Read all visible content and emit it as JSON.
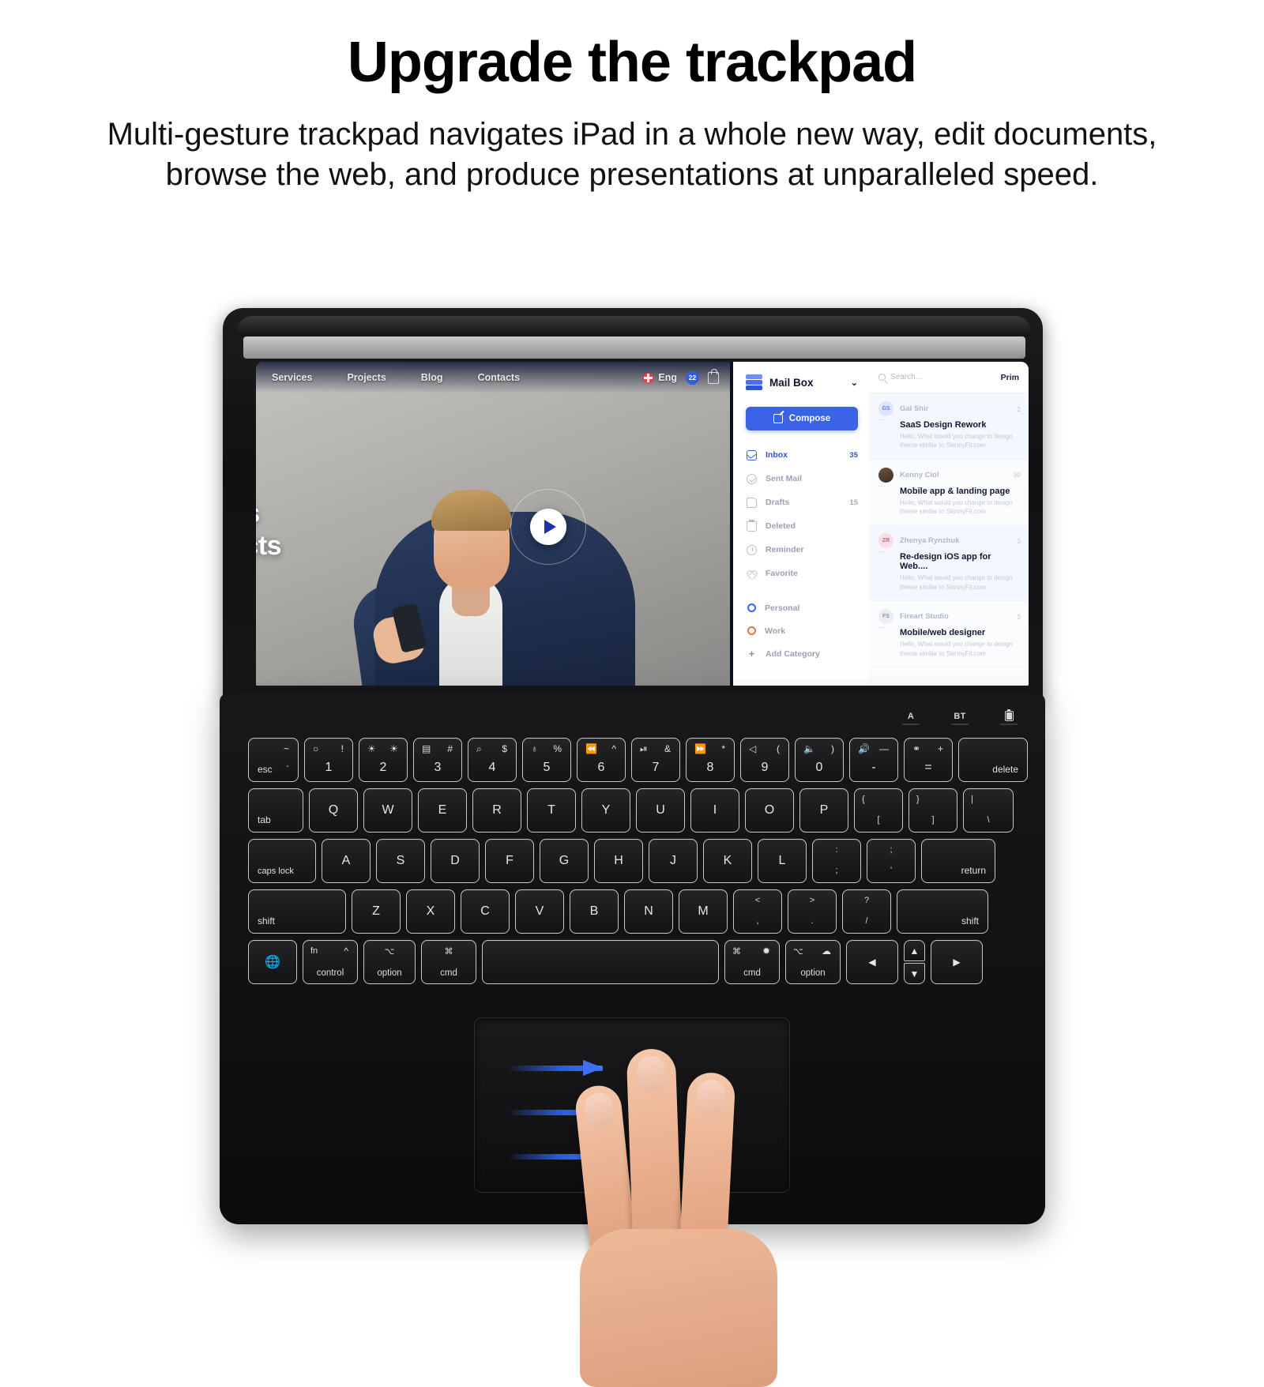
{
  "header": {
    "headline": "Upgrade the trackpad",
    "subhead": "Multi-gesture trackpad navigates iPad in a whole new way, edit documents, browse the web, and produce presentations at unparalleled speed."
  },
  "website": {
    "nav": [
      "Services",
      "Projects",
      "Blog",
      "Contacts"
    ],
    "language": "Eng",
    "cart_count": "22",
    "hero_line1": "ns",
    "hero_line2": "ects"
  },
  "mail": {
    "brand_title": "Mail Box",
    "chevron": "⌄",
    "compose_label": "Compose",
    "search_placeholder": "Search...",
    "primary_tab": "Prim",
    "folders": [
      {
        "label": "Inbox",
        "count": "35",
        "icon": "envelope-icon"
      },
      {
        "label": "Sent Mail",
        "count": "",
        "icon": "check-circle-icon"
      },
      {
        "label": "Drafts",
        "count": "15",
        "icon": "document-icon"
      },
      {
        "label": "Deleted",
        "count": "",
        "icon": "trash-icon"
      },
      {
        "label": "Reminder",
        "count": "",
        "icon": "clock-icon"
      },
      {
        "label": "Favorite",
        "count": "",
        "icon": "heart-icon"
      }
    ],
    "categories": [
      {
        "label": "Personal",
        "color": "#3b63e8"
      },
      {
        "label": "Work",
        "color": "#e8763b"
      }
    ],
    "add_category_label": "Add Category",
    "messages": [
      {
        "initials": "GS",
        "sender": "Gal Shir",
        "date": "2",
        "subject": "SaaS Design Rework",
        "preview": "Hello, What would you change to design theme similar to SkinnyFit.com"
      },
      {
        "initials": "",
        "sender": "Kenny Ciol",
        "date": "30",
        "subject": "Mobile app & landing page",
        "preview": "Hello, What would you change to design theme similar to SkinnyFit.com"
      },
      {
        "initials": "ZR",
        "sender": "Zhenya Rynzhuk",
        "date": "3",
        "subject": "Re-design iOS app for Web....",
        "preview": "Hello, What would you change to design theme similar to SkinnyFit.com"
      },
      {
        "initials": "FS",
        "sender": "Fireart Studio",
        "date": "3",
        "subject": "Mobile/web designer",
        "preview": "Hello, What would you change to design theme similar to SkinnyFit.com"
      }
    ]
  },
  "keyboard": {
    "indicators": [
      {
        "label": "A",
        "icon": "caps-lock-indicator"
      },
      {
        "label": "BT",
        "icon": "bluetooth-indicator"
      },
      {
        "label": "",
        "icon": "battery-indicator"
      }
    ],
    "row_function": [
      {
        "main": "esc",
        "topleft": "",
        "topright": "~",
        "sub": "`"
      },
      {
        "main": "1",
        "topleft": "○",
        "topright": "!"
      },
      {
        "main": "2",
        "topleft": "☀",
        "topright": "☀"
      },
      {
        "main": "3",
        "topleft": "▤",
        "topright": "#"
      },
      {
        "main": "4",
        "topleft": "⌕",
        "topright": "$"
      },
      {
        "main": "5",
        "topleft": "♁",
        "topright": "%"
      },
      {
        "main": "6",
        "topleft": "⏪",
        "topright": "^"
      },
      {
        "main": "7",
        "topleft": "⏯",
        "topright": "&"
      },
      {
        "main": "8",
        "topleft": "⏩",
        "topright": "*"
      },
      {
        "main": "9",
        "topleft": "ᴉ",
        "topright": "("
      },
      {
        "main": "0",
        "topleft": "ᴊ",
        "topright": ")"
      },
      {
        "main": "-",
        "topleft": "ᴋ",
        "topright": "—"
      },
      {
        "main": "=",
        "topleft": "⚭",
        "topright": "+"
      },
      {
        "main": "delete"
      }
    ],
    "row_q": [
      "tab",
      "Q",
      "W",
      "E",
      "R",
      "T",
      "Y",
      "U",
      "I",
      "O",
      "P",
      "{",
      "}",
      "|"
    ],
    "row_q_sub": [
      "",
      "",
      "",
      "",
      "",
      "",
      "",
      "",
      "",
      "",
      "",
      "[",
      "]",
      "\\"
    ],
    "row_a": [
      "caps lock",
      "A",
      "S",
      "D",
      "F",
      "G",
      "H",
      "J",
      "K",
      "L",
      ":",
      ";",
      "return"
    ],
    "row_a_sub": [
      "",
      "",
      "",
      "",
      "",
      "",
      "",
      "",
      "",
      "",
      ";",
      "'",
      ""
    ],
    "row_z": [
      "shift",
      "Z",
      "X",
      "C",
      "V",
      "B",
      "N",
      "M",
      "<",
      ">",
      "?",
      "shift"
    ],
    "row_z_sub": [
      "",
      "",
      "",
      "",
      "",
      "",
      "",
      "",
      ",",
      ".",
      "/",
      ""
    ],
    "row_bottom": [
      {
        "label": "",
        "icon": "globe-icon"
      },
      {
        "label": "control",
        "top1": "fn",
        "top2": "^"
      },
      {
        "label": "option",
        "top1": "⌥",
        "top2": ""
      },
      {
        "label": "cmd",
        "top1": "⌘",
        "top2": ""
      },
      {
        "label": "",
        "icon": "space-bar"
      },
      {
        "label": "cmd",
        "top1": "⌘",
        "top2": "✹"
      },
      {
        "label": "option",
        "top1": "⌥",
        "top2": "☁"
      },
      {
        "label": "",
        "icon": "arrow-left-key",
        "glyph": "◀"
      },
      {
        "label": "",
        "icon": "arrow-updown-key",
        "glyph_up": "▲",
        "glyph_down": "▼"
      },
      {
        "label": "",
        "icon": "arrow-right-key",
        "glyph": "▶"
      }
    ]
  },
  "trackpad": {
    "gesture": "three-finger-swipe-right",
    "arrow_color": "#3f6ff2",
    "arrow_count": 3
  }
}
